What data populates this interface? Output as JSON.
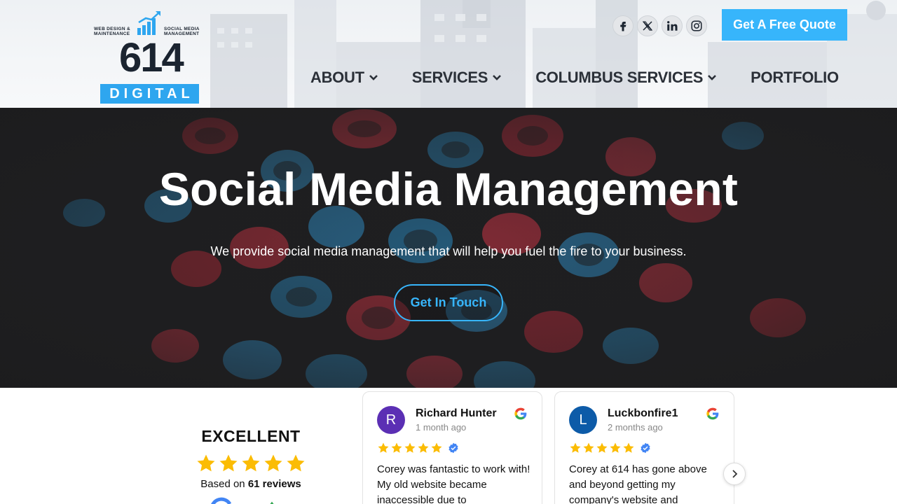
{
  "header": {
    "logo": {
      "tagline_left": "WEB DESIGN & MAINTENANCE",
      "tagline_right": "SOCIAL MEDIA MANAGEMENT",
      "number": "614",
      "word": "DIGITAL"
    },
    "socials": [
      "facebook-icon",
      "x-icon",
      "linkedin-icon",
      "instagram-icon"
    ],
    "quote_button": "Get A Free Quote",
    "nav": {
      "about": "ABOUT",
      "services": "SERVICES",
      "columbus": "COLUMBUS SERVICES",
      "portfolio": "PORTFOLIO"
    }
  },
  "hero": {
    "title": "Social Media Management",
    "subtitle": "We provide social media management that will help you fuel the fire to your business.",
    "cta": "Get In Touch"
  },
  "reviews": {
    "rating_word": "EXCELLENT",
    "stars": 5,
    "based_prefix": "Based on",
    "based_count": "61 reviews",
    "items": [
      {
        "initial": "R",
        "name": "Richard Hunter",
        "time": "1 month ago",
        "stars": 5,
        "text": "Corey was fantastic to work with! My old website became inaccessible due to",
        "avatar_color": "#5b2fb4"
      },
      {
        "initial": "L",
        "name": "Luckbonfire1",
        "time": "2 months ago",
        "stars": 5,
        "text": "Corey at 614 has gone above and beyond getting my company's website and",
        "avatar_color": "#0d5ba8"
      }
    ]
  },
  "colors": {
    "accent": "#37b5fb",
    "nav_text": "#2b3038",
    "star": "#fbbc04"
  }
}
